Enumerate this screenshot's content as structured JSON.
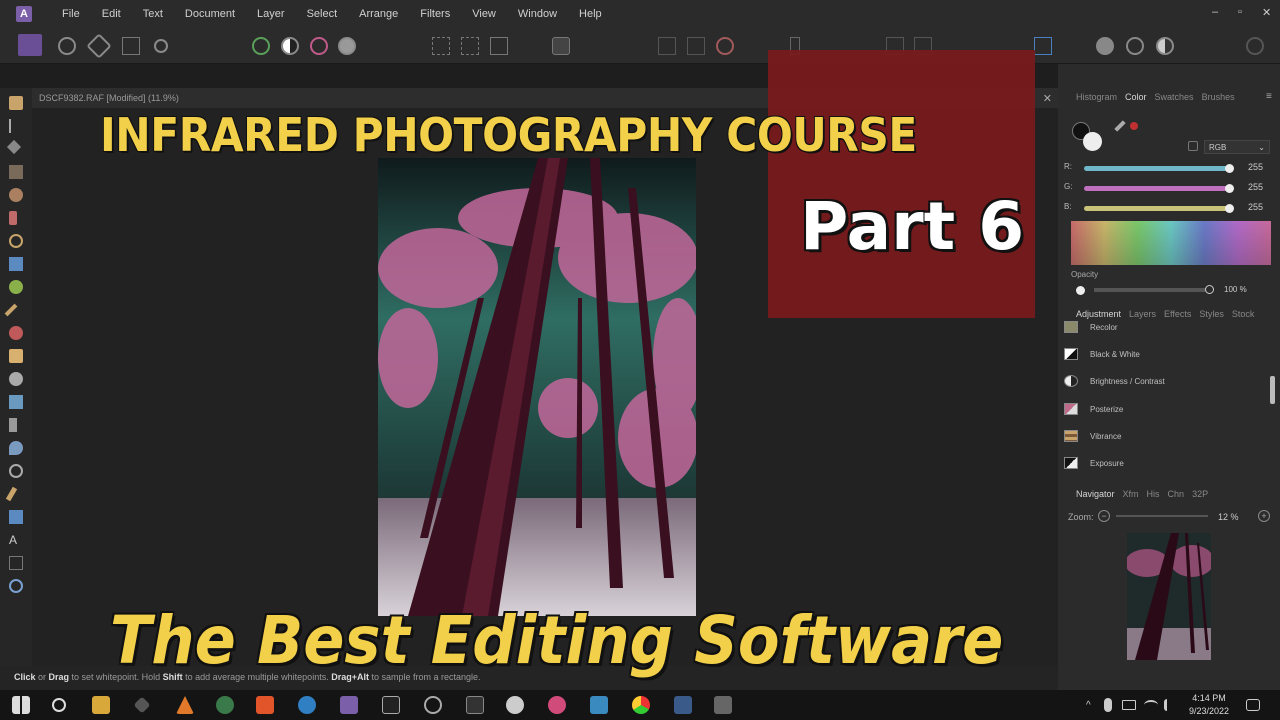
{
  "menu": {
    "items": [
      "File",
      "Edit",
      "Text",
      "Document",
      "Layer",
      "Select",
      "Arrange",
      "Filters",
      "View",
      "Window",
      "Help"
    ]
  },
  "window_controls": {
    "minimize": "–",
    "restore": "▫",
    "close": "✕"
  },
  "document": {
    "tab_title": "DSCF9382.RAF [Modified] (11.9%)",
    "close": "✕"
  },
  "overlay": {
    "title": "INFRARED PHOTOGRAPHY COURSE",
    "part": "Part 6",
    "subtitle": "The Best Editing Software"
  },
  "status": {
    "click": "Click",
    "or": " or ",
    "drag": "Drag",
    "text1": " to set whitepoint. Hold ",
    "shift": "Shift",
    "text2": " to add average multiple whitepoints. ",
    "dragalt": "Drag+Alt",
    "text3": " to sample from a rectangle."
  },
  "color_panel": {
    "tabs": [
      "Histogram",
      "Color",
      "Swatches",
      "Brushes"
    ],
    "active_tab": "Color",
    "mode": "RGB",
    "channels": [
      {
        "label": "R:",
        "value": "255",
        "color": "#6fb7c9"
      },
      {
        "label": "G:",
        "value": "255",
        "color": "#c06fbf"
      },
      {
        "label": "B:",
        "value": "255",
        "color": "#c9c37a"
      }
    ],
    "opacity_label": "Opacity",
    "opacity_value": "100 %"
  },
  "adjust_panel": {
    "tabs": [
      "Adjustment",
      "Layers",
      "Effects",
      "Styles",
      "Stock"
    ],
    "active_tab": "Adjustment",
    "items": [
      "Recolor",
      "Black & White",
      "Brightness / Contrast",
      "Posterize",
      "Vibrance",
      "Exposure"
    ]
  },
  "nav_panel": {
    "tabs": [
      "Navigator",
      "Xfm",
      "His",
      "Chn",
      "32P"
    ],
    "active_tab": "Navigator",
    "zoom_label": "Zoom:",
    "zoom_value": "12 %",
    "minus": "−",
    "plus": "+"
  },
  "taskbar": {
    "time": "4:14 PM",
    "date": "9/23/2022"
  },
  "colors": {
    "accent": "#7b5fa8",
    "overlay_yellow": "#f3d04a",
    "overlay_red": "#7a1a1c",
    "sky": "#2f6d62",
    "foliage": "#c2679a"
  }
}
